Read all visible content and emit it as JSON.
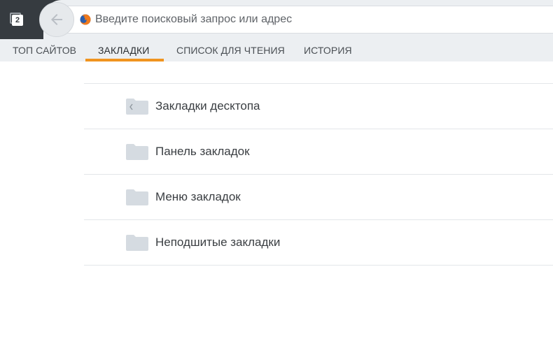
{
  "toolbar": {
    "tab_count": "2",
    "url_placeholder": "Введите поисковый запрос или адрес"
  },
  "tabs": [
    {
      "label": "ТОП САЙТОВ",
      "active": false
    },
    {
      "label": "ЗАКЛАДКИ",
      "active": true
    },
    {
      "label": "СПИСОК ДЛЯ ЧТЕНИЯ",
      "active": false
    },
    {
      "label": "ИСТОРИЯ",
      "active": false
    }
  ],
  "bookmarks": {
    "items": [
      {
        "label": "Закладки десктопа",
        "icon": "desktop-folder-icon"
      },
      {
        "label": "Панель закладок",
        "icon": "folder-icon"
      },
      {
        "label": "Меню закладок",
        "icon": "folder-icon"
      },
      {
        "label": "Неподшитые закладки",
        "icon": "folder-icon"
      }
    ]
  },
  "colors": {
    "accent": "#f0941f",
    "toolbar_dark": "#363b40",
    "tabstrip_bg": "#eceff2",
    "folder": "#d5dbe1"
  }
}
